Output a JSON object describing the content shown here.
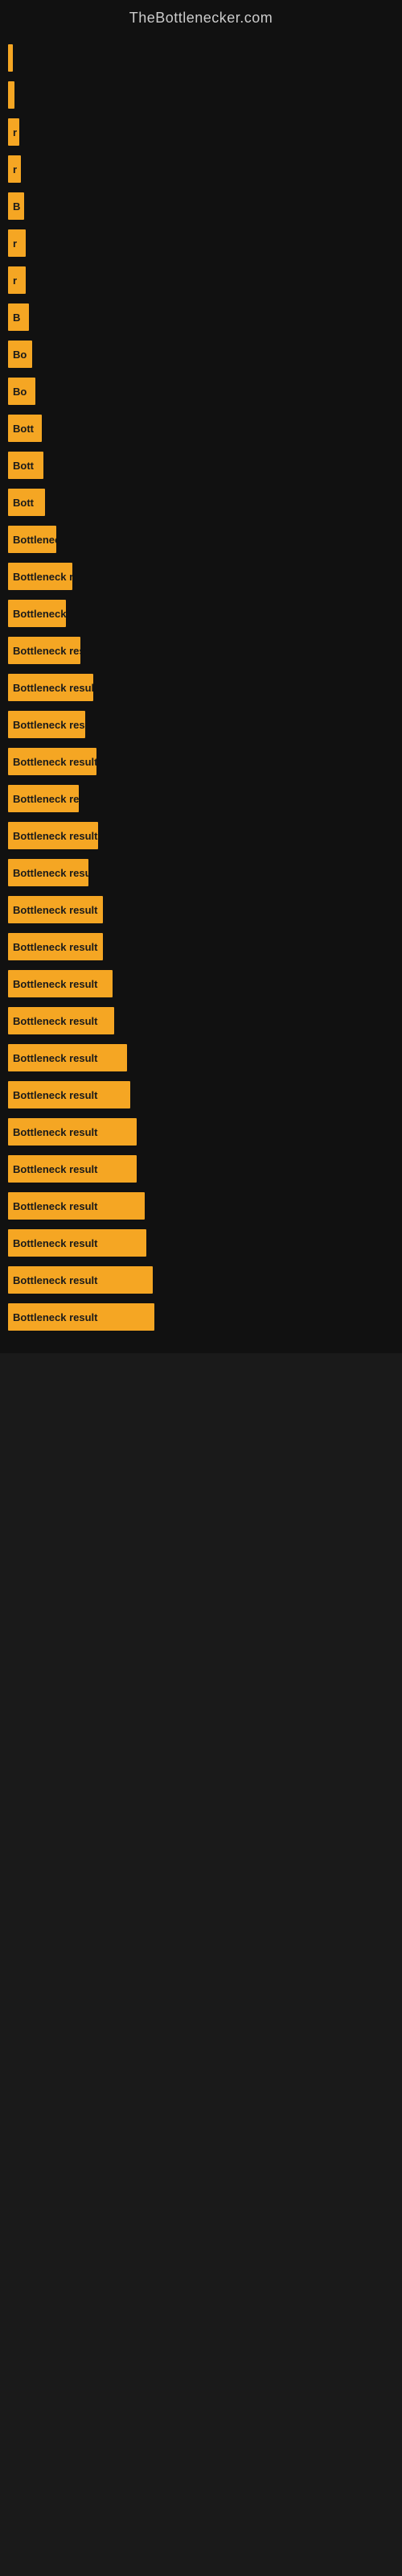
{
  "site": {
    "title": "TheBottlenecker.com"
  },
  "bars": [
    {
      "id": 1,
      "width": 6,
      "label": ""
    },
    {
      "id": 2,
      "width": 8,
      "label": ""
    },
    {
      "id": 3,
      "width": 14,
      "label": "r"
    },
    {
      "id": 4,
      "width": 16,
      "label": "r"
    },
    {
      "id": 5,
      "width": 20,
      "label": "B"
    },
    {
      "id": 6,
      "width": 22,
      "label": "r"
    },
    {
      "id": 7,
      "width": 22,
      "label": "r"
    },
    {
      "id": 8,
      "width": 26,
      "label": "B"
    },
    {
      "id": 9,
      "width": 30,
      "label": "Bo"
    },
    {
      "id": 10,
      "width": 34,
      "label": "Bo"
    },
    {
      "id": 11,
      "width": 42,
      "label": "Bott"
    },
    {
      "id": 12,
      "width": 44,
      "label": "Bott"
    },
    {
      "id": 13,
      "width": 46,
      "label": "Bott"
    },
    {
      "id": 14,
      "width": 60,
      "label": "Bottlenec"
    },
    {
      "id": 15,
      "width": 80,
      "label": "Bottleneck re"
    },
    {
      "id": 16,
      "width": 72,
      "label": "Bottleneck"
    },
    {
      "id": 17,
      "width": 90,
      "label": "Bottleneck resu"
    },
    {
      "id": 18,
      "width": 106,
      "label": "Bottleneck result"
    },
    {
      "id": 19,
      "width": 96,
      "label": "Bottleneck resu"
    },
    {
      "id": 20,
      "width": 110,
      "label": "Bottleneck result"
    },
    {
      "id": 21,
      "width": 88,
      "label": "Bottleneck re"
    },
    {
      "id": 22,
      "width": 112,
      "label": "Bottleneck result"
    },
    {
      "id": 23,
      "width": 100,
      "label": "Bottleneck resu"
    },
    {
      "id": 24,
      "width": 118,
      "label": "Bottleneck result"
    },
    {
      "id": 25,
      "width": 118,
      "label": "Bottleneck result"
    },
    {
      "id": 26,
      "width": 130,
      "label": "Bottleneck result"
    },
    {
      "id": 27,
      "width": 132,
      "label": "Bottleneck result"
    },
    {
      "id": 28,
      "width": 148,
      "label": "Bottleneck result"
    },
    {
      "id": 29,
      "width": 152,
      "label": "Bottleneck result"
    },
    {
      "id": 30,
      "width": 160,
      "label": "Bottleneck result"
    },
    {
      "id": 31,
      "width": 160,
      "label": "Bottleneck result"
    },
    {
      "id": 32,
      "width": 170,
      "label": "Bottleneck result"
    },
    {
      "id": 33,
      "width": 172,
      "label": "Bottleneck result"
    },
    {
      "id": 34,
      "width": 180,
      "label": "Bottleneck result"
    },
    {
      "id": 35,
      "width": 182,
      "label": "Bottleneck result"
    }
  ]
}
